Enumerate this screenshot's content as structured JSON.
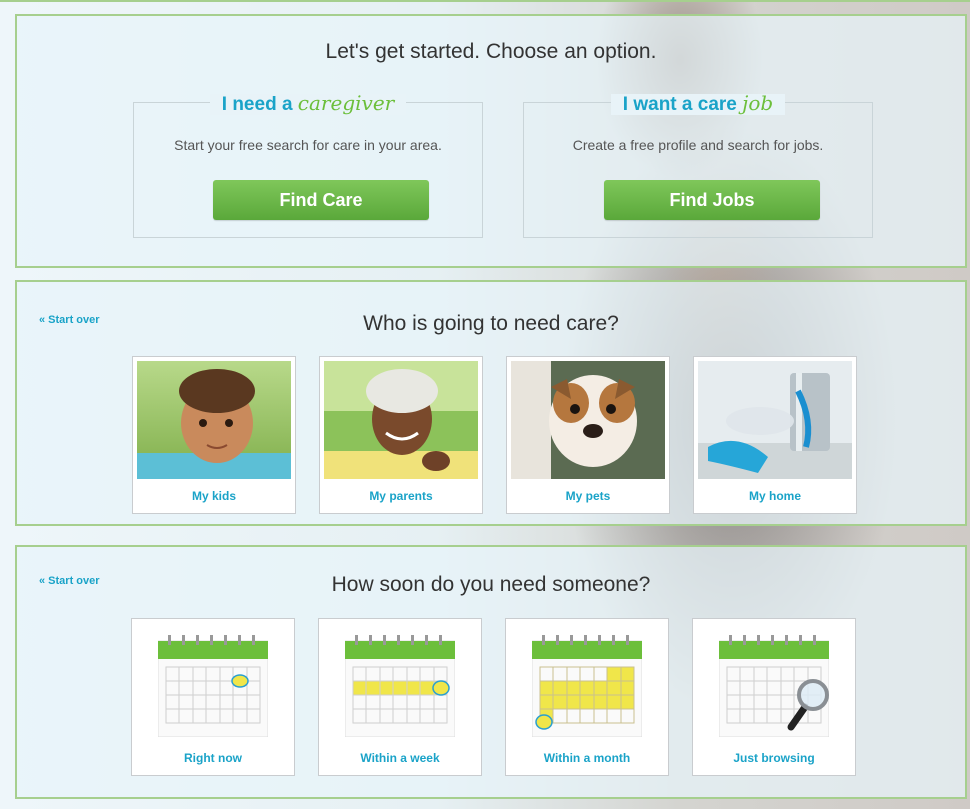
{
  "step1": {
    "heading": "Let's get started. Choose an option.",
    "care_option": {
      "title_prefix": "I need a",
      "title_script": "caregiver",
      "description": "Start your free search for care in your area.",
      "button": "Find Care"
    },
    "job_option": {
      "title_prefix": "I want a care",
      "title_script": "job",
      "description": "Create a free profile and search for jobs.",
      "button": "Find Jobs"
    }
  },
  "step2": {
    "start_over": "« Start over",
    "heading": "Who is going to need care?",
    "options": [
      {
        "label": "My kids",
        "image": "baby-photo"
      },
      {
        "label": "My parents",
        "image": "senior-woman-photo"
      },
      {
        "label": "My pets",
        "image": "bulldog-photo"
      },
      {
        "label": "My home",
        "image": "cleaning-supplies-photo"
      }
    ]
  },
  "step3": {
    "start_over": "« Start over",
    "heading": "How soon do you need someone?",
    "options": [
      {
        "label": "Right now",
        "image": "calendar-today-icon"
      },
      {
        "label": "Within a week",
        "image": "calendar-week-icon"
      },
      {
        "label": "Within a month",
        "image": "calendar-month-icon"
      },
      {
        "label": "Just browsing",
        "image": "calendar-magnifier-icon"
      }
    ]
  },
  "colors": {
    "accent_blue": "#1aa3c8",
    "accent_green": "#6cbf3b",
    "button_green": "#67b447",
    "panel_border": "#a6cf8e",
    "highlight_yellow": "#f0e64a"
  }
}
